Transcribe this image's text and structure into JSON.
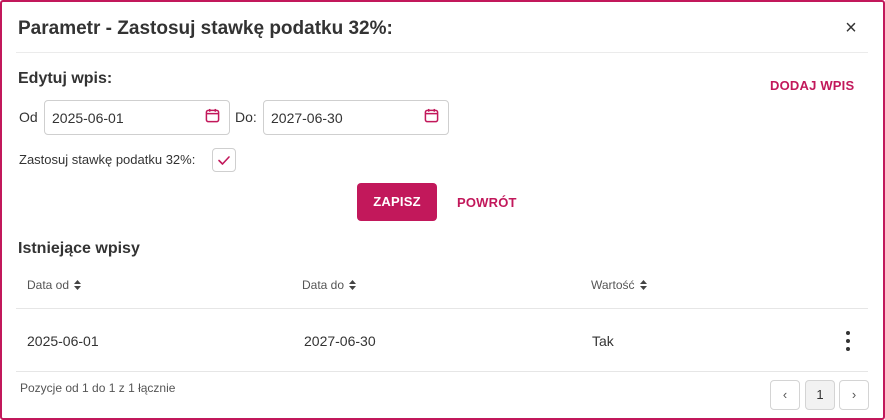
{
  "dialog": {
    "title": "Parametr - Zastosuj stawkę podatku 32%:",
    "close_symbol": "×",
    "close_icon": "close-icon"
  },
  "edit": {
    "heading": "Edytuj wpis:",
    "add_entry_label": "DODAJ WPIS",
    "from_label": "Od",
    "from_value": "2025-06-01",
    "to_label": "Do:",
    "to_value": "2027-06-30",
    "calendar_icon": "calendar-icon",
    "checkbox_label": "Zastosuj stawkę podatku 32%:",
    "checkbox_checked": true,
    "save_label": "ZAPISZ",
    "back_label": "POWRÓT"
  },
  "entries": {
    "heading": "Istniejące wpisy",
    "columns": [
      "Data od",
      "Data do",
      "Wartość"
    ],
    "sort_icon": "sort-icon",
    "rows": [
      {
        "date_from": "2025-06-01",
        "date_to": "2027-06-30",
        "value": "Tak",
        "actions_icon": "more-vert-icon"
      }
    ],
    "summary": "Pozycje od 1 do 1 z 1 łącznie",
    "pagination": {
      "prev": "‹",
      "current_page": "1",
      "next": "›"
    }
  },
  "colors": {
    "accent": "#c2185b",
    "border": "#cfcfcf",
    "text": "#333333"
  }
}
